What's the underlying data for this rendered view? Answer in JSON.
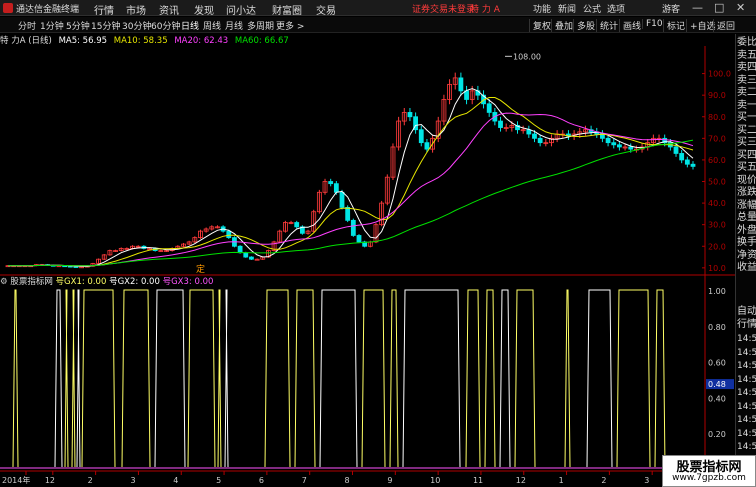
{
  "app": {
    "title": "通达信金融终端",
    "menu": [
      "行情",
      "市场",
      "资讯",
      "发现",
      "问小达",
      "财富圈",
      "交易"
    ],
    "login_hint": "证券交易未登录",
    "stock_header": "特 力 A",
    "right_menu": [
      "功能",
      "新闻",
      "公式",
      "选项",
      "游客"
    ],
    "window_buttons": [
      "—",
      "□",
      "✕"
    ]
  },
  "toolbar": {
    "periods": [
      "分时",
      "1分钟",
      "5分钟",
      "15分钟",
      "30分钟",
      "60分钟",
      "日线",
      "周线",
      "月线",
      "多周期",
      "更多 >"
    ],
    "active_period": "日线",
    "right_buttons": [
      "复权",
      "叠加",
      "多股",
      "统计",
      "画线",
      "F10",
      "标记",
      "+自选",
      "返回"
    ]
  },
  "info": {
    "stock": "特 力A (日线)",
    "ma5": "MA5: 56.95",
    "ma10": "MA10: 58.35",
    "ma20": "MA20: 62.43",
    "ma60": "MA60: 66.67"
  },
  "indicator": {
    "name": "股票指标网",
    "gx1": "号GX1: 0.00",
    "gx2": "号GX2: 0.00",
    "gx3": "号GX3: 0.00",
    "current_value": "0.48"
  },
  "side_panel": {
    "items": [
      "委比",
      "卖五",
      "卖四",
      "卖三",
      "卖二",
      "卖一",
      "买一",
      "买二",
      "买三",
      "买四",
      "买五",
      "现价",
      "涨跌",
      "涨幅",
      "总量",
      "外盘",
      "换手",
      "净资",
      "收益"
    ],
    "auto_label": "自动",
    "quote_label": "行情",
    "times": [
      "14:5",
      "14:5",
      "14:5",
      "14:5",
      "14:5",
      "14:5",
      "14:5",
      "14:5",
      "14:5",
      "14:5"
    ]
  },
  "colors": {
    "ma5": "#ffffff",
    "ma10": "#e6e600",
    "ma20": "#ff40ff",
    "ma60": "#00e000",
    "up": "#ff3b3b",
    "down": "#00e5e5",
    "axis": "#b00000",
    "gx1": "#ffff66",
    "gx2": "#ffffff",
    "gx3": "#ff55ff"
  },
  "watermark": {
    "title": "股票指标网",
    "url": "www.7gpzb.com"
  },
  "chart_data": [
    {
      "type": "candlestick",
      "title": "特力A (日线)",
      "ylim": [
        9,
        110
      ],
      "y_ticks": [
        "100.0",
        "90.0",
        "80.0",
        "70.0",
        "60.0",
        "50.0",
        "40.0",
        "30.0",
        "20.0",
        "10.0"
      ],
      "x_ticks": [
        "2014年",
        "12",
        "2",
        "3",
        "4",
        "5",
        "6",
        "7",
        "8",
        "9",
        "10",
        "11",
        "12",
        "1",
        "2",
        "3",
        "4"
      ],
      "annotations": [
        {
          "text": "108.00",
          "x": "12",
          "y": 108.0
        }
      ],
      "marker": "定",
      "close_series": [
        11,
        11,
        11,
        11,
        11,
        11.5,
        11.5,
        11.2,
        11,
        11,
        10.8,
        10.6,
        10.5,
        10.5,
        10.8,
        12,
        14,
        16,
        18,
        18,
        19,
        19,
        20,
        20,
        19,
        19,
        18,
        18,
        18,
        19,
        20,
        21,
        22,
        24,
        27,
        28,
        29,
        29,
        27,
        24,
        20,
        17,
        15,
        14,
        14,
        15,
        18,
        22,
        27,
        31,
        31,
        29,
        26,
        27,
        36,
        45,
        50,
        49,
        45,
        38,
        32,
        25,
        22,
        20,
        22,
        30,
        40,
        52,
        66,
        78,
        82,
        80,
        74,
        68,
        65,
        70,
        78,
        88,
        95,
        98,
        92,
        88,
        92,
        90,
        86,
        82,
        78,
        75,
        75,
        76,
        74,
        74,
        72,
        70,
        68,
        68,
        70,
        72,
        72,
        71,
        72,
        73,
        74,
        73,
        72,
        70,
        68,
        67,
        66,
        66,
        65,
        65,
        66,
        68,
        70,
        70,
        68,
        66,
        63,
        60,
        58,
        57
      ]
    },
    {
      "type": "line",
      "title": "股票指标网",
      "series": [
        {
          "name": "GX1",
          "values": [
            0,
            0,
            0,
            0
          ]
        },
        {
          "name": "GX2",
          "values": [
            0,
            0,
            0,
            0
          ]
        },
        {
          "name": "GX3",
          "values": [
            0,
            0,
            0,
            0
          ]
        }
      ],
      "ylim": [
        0,
        1.0
      ],
      "y_ticks": [
        "1.00",
        "0.80",
        "0.60",
        "0.40",
        "0.20"
      ],
      "signal_positions_x": [
        13,
        18,
        55,
        62,
        65,
        68,
        72,
        75,
        77,
        80,
        82,
        115,
        122,
        150,
        155,
        185,
        188,
        215,
        218,
        221,
        225,
        228,
        265,
        290,
        295,
        315,
        320,
        357,
        362,
        385,
        390,
        398,
        403,
        460,
        466,
        480,
        485,
        495,
        500,
        510,
        515,
        535,
        565,
        570,
        587,
        612,
        617,
        650,
        655,
        665,
        670
      ]
    }
  ]
}
